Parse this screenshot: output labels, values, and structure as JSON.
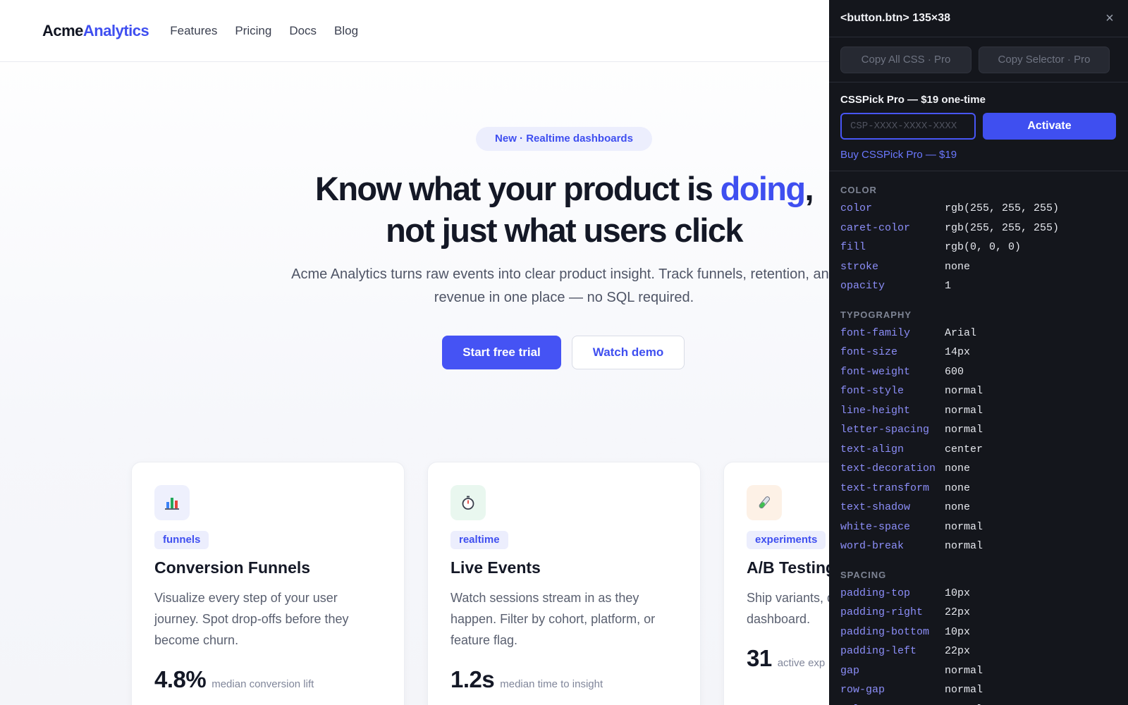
{
  "site": {
    "logo_main": "Acme",
    "logo_accent": "Analytics",
    "nav": [
      "Features",
      "Pricing",
      "Docs",
      "Blog"
    ]
  },
  "hero": {
    "badge": "New · Realtime dashboards",
    "headline_part1": "Know what your product is ",
    "headline_accent": "doing",
    "headline_part2": ",",
    "headline_line2": "not just what users click",
    "subhead": "Acme Analytics turns raw events into clear product insight. Track funnels, retention, and revenue in one place — no SQL required.",
    "cta_primary": "Start free trial",
    "cta_secondary": "Watch demo"
  },
  "cards": [
    {
      "icon": "bar-chart-icon",
      "icon_bg": "#eef0fd",
      "tag": "funnels",
      "title": "Conversion Funnels",
      "desc": "Visualize every step of your user journey. Spot drop-offs before they become churn.",
      "metric_value": "4.8%",
      "metric_label": "median conversion lift"
    },
    {
      "icon": "stopwatch-icon",
      "icon_bg": "#e9f7ef",
      "tag": "realtime",
      "title": "Live Events",
      "desc": "Watch sessions stream in as they happen. Filter by cohort, platform, or feature flag.",
      "metric_value": "1.2s",
      "metric_label": "median time to insight"
    },
    {
      "icon": "test-tube-icon",
      "icon_bg": "#fdf1e6",
      "tag": "experiments",
      "title": "A/B Testing",
      "desc": "Ship variants, declare winners, dashboard.",
      "metric_value": "31",
      "metric_label": "active exp"
    }
  ],
  "inspector": {
    "title": "<button.btn> 135×38",
    "close": "×",
    "copy_all": "Copy All CSS · Pro",
    "copy_selector": "Copy Selector · Pro",
    "pro_title": "CSSPick Pro — $19 one-time",
    "license_placeholder": "CSP-XXXX-XXXX-XXXX",
    "activate": "Activate",
    "buy_link": "Buy CSSPick Pro — $19",
    "sections": [
      {
        "label": "COLOR",
        "props": [
          {
            "k": "color",
            "v": "rgb(255, 255, 255)"
          },
          {
            "k": "caret-color",
            "v": "rgb(255, 255, 255)"
          },
          {
            "k": "fill",
            "v": "rgb(0, 0, 0)"
          },
          {
            "k": "stroke",
            "v": "none"
          },
          {
            "k": "opacity",
            "v": "1"
          }
        ]
      },
      {
        "label": "TYPOGRAPHY",
        "props": [
          {
            "k": "font-family",
            "v": "Arial"
          },
          {
            "k": "font-size",
            "v": "14px"
          },
          {
            "k": "font-weight",
            "v": "600"
          },
          {
            "k": "font-style",
            "v": "normal"
          },
          {
            "k": "line-height",
            "v": "normal"
          },
          {
            "k": "letter-spacing",
            "v": "normal"
          },
          {
            "k": "text-align",
            "v": "center"
          },
          {
            "k": "text-decoration",
            "v": "none"
          },
          {
            "k": "text-transform",
            "v": "none"
          },
          {
            "k": "text-shadow",
            "v": "none"
          },
          {
            "k": "white-space",
            "v": "normal"
          },
          {
            "k": "word-break",
            "v": "normal"
          }
        ]
      },
      {
        "label": "SPACING",
        "props": [
          {
            "k": "padding-top",
            "v": "10px"
          },
          {
            "k": "padding-right",
            "v": "22px"
          },
          {
            "k": "padding-bottom",
            "v": "10px"
          },
          {
            "k": "padding-left",
            "v": "22px"
          },
          {
            "k": "gap",
            "v": "normal"
          },
          {
            "k": "row-gap",
            "v": "normal"
          },
          {
            "k": "column-gap",
            "v": "normal"
          }
        ]
      }
    ]
  }
}
